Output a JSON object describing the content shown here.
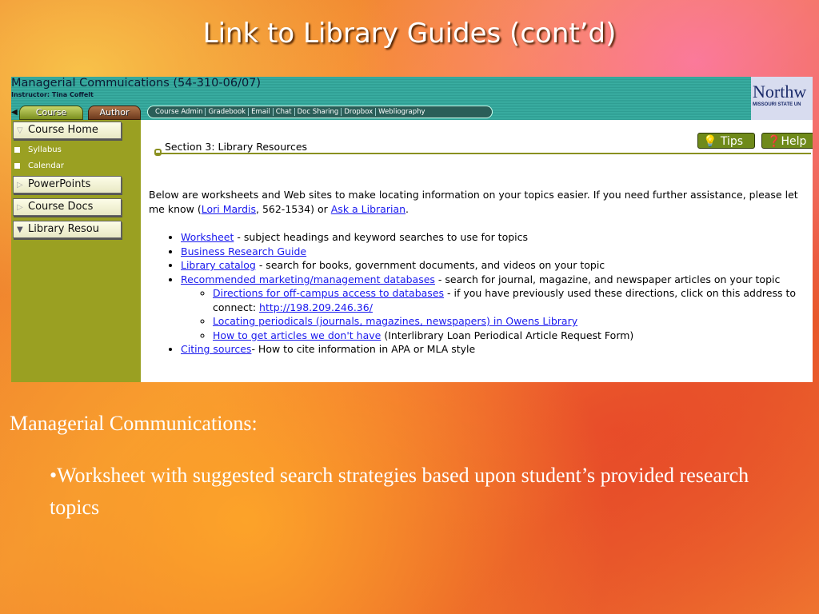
{
  "slide": {
    "title": "Link to Library Guides (cont’d)",
    "heading": "Managerial Communications:",
    "bullet": "•Worksheet with suggested search strategies based upon student’s provided research topics"
  },
  "course": {
    "title": "Managerial Commuications (54-310-06/07)",
    "instructor": "Instructor: Tina Coffelt"
  },
  "logo": {
    "name": "Northw",
    "subtitle": "MISSOURI STATE UN"
  },
  "tabs": {
    "course": "Course",
    "author": "Author"
  },
  "nav": [
    "Course Admin",
    "Gradebook",
    "Email",
    "Chat",
    "Doc Sharing",
    "Dropbox",
    "Webliography"
  ],
  "sidebar": {
    "course_home": "Course Home",
    "syllabus": "Syllabus",
    "calendar": "Calendar",
    "powerpoints": "PowerPoints",
    "course_docs": "Course Docs",
    "library": "Library Resou"
  },
  "content": {
    "tips": "Tips",
    "help": "Help",
    "section_title": "Section 3:  Library Resources",
    "intro_1": "Below are worksheets and Web sites to make locating information on your topics easier.  If you need further assistance, please let me know (",
    "intro_link1": "Lori Mardis",
    "intro_2": ", 562-1534) or ",
    "intro_link2": "Ask a Librarian",
    "intro_3": ".",
    "items": [
      {
        "link": "Worksheet",
        "text": " - subject headings and keyword searches to use for topics"
      },
      {
        "link": "Business Research Guide",
        "text": ""
      },
      {
        "link": "Library catalog",
        "text": " - search for books, government documents, and videos on your topic"
      },
      {
        "link": "Recommended marketing/management databases",
        "text": " - search for journal, magazine, and newspaper articles on your topic"
      },
      {
        "link": "Citing sources",
        "text": "- How to cite information in APA or MLA style"
      }
    ],
    "subitems": [
      {
        "link": "Directions for off-campus access to databases",
        "text": " - if you have previously used these directions, click on this address to connect: ",
        "link2": "http://198.209.246.36/"
      },
      {
        "link": "Locating periodicals (journals, magazines, newspapers) in Owens Library",
        "text": ""
      },
      {
        "link": "How to get articles we don't have",
        "text": " (Interlibrary Loan Periodical Article Request Form)"
      }
    ]
  }
}
